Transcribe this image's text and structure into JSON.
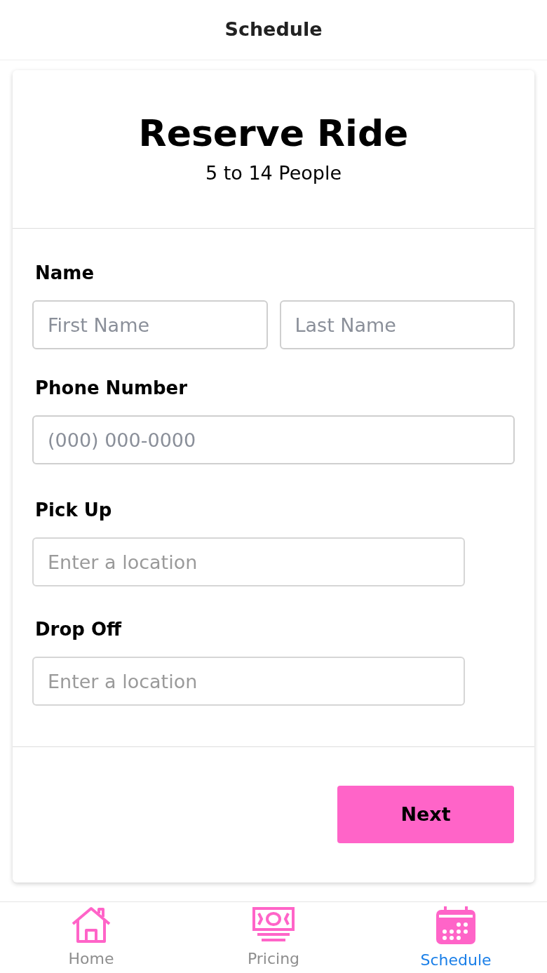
{
  "header": {
    "title": "Schedule"
  },
  "card": {
    "title": "Reserve Ride",
    "subtitle": "5 to 14 People",
    "sections": [
      {
        "label": "Name",
        "kind": "pair",
        "fields": [
          {
            "placeholder": "First Name"
          },
          {
            "placeholder": "Last Name"
          }
        ]
      },
      {
        "label": "Phone Number",
        "kind": "full",
        "fields": [
          {
            "placeholder": "(000) 000-0000"
          }
        ]
      },
      {
        "label": "Pick Up",
        "kind": "location",
        "fields": [
          {
            "placeholder": "Enter a location"
          }
        ]
      },
      {
        "label": "Drop Off",
        "kind": "location",
        "fields": [
          {
            "placeholder": "Enter a location"
          }
        ]
      }
    ],
    "button": "Next"
  },
  "tabs": [
    {
      "label": "Home",
      "kind": "home",
      "selected": false
    },
    {
      "label": "Pricing",
      "kind": "money",
      "selected": false
    },
    {
      "label": "Schedule",
      "kind": "calendar",
      "selected": true
    }
  ]
}
